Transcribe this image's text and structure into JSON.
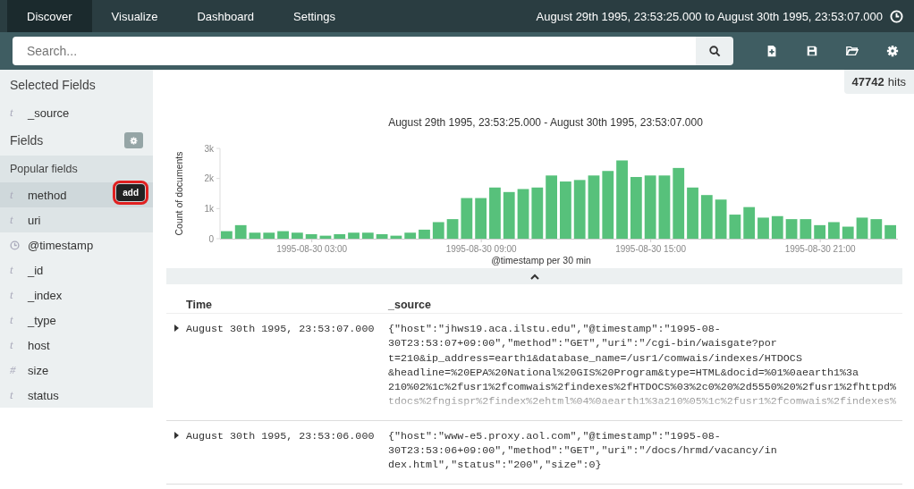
{
  "nav": {
    "tabs": [
      {
        "label": "Discover",
        "selected": true
      },
      {
        "label": "Visualize",
        "selected": false
      },
      {
        "label": "Dashboard",
        "selected": false
      },
      {
        "label": "Settings",
        "selected": false
      }
    ],
    "time_range": "August 29th 1995, 23:53:25.000 to August 30th 1995, 23:53:07.000"
  },
  "search": {
    "placeholder": "Search..."
  },
  "toolbar": [
    {
      "kind": "new"
    },
    {
      "kind": "save"
    },
    {
      "kind": "open"
    },
    {
      "kind": "settings"
    }
  ],
  "sidebar": {
    "selected_title": "Selected Fields",
    "selected_fields": [
      {
        "kind": "letter",
        "type_icon": "t",
        "name": "_source"
      }
    ],
    "fields_title": "Fields",
    "popular_title": "Popular fields",
    "popular_fields": [
      {
        "kind": "letter",
        "type_icon": "t",
        "name": "method",
        "add_button": {
          "label": "add",
          "highlighted": true
        }
      },
      {
        "kind": "letter",
        "type_icon": "t",
        "name": "uri"
      }
    ],
    "fields": [
      {
        "kind": "date",
        "name": "@timestamp"
      },
      {
        "kind": "letter",
        "type_icon": "t",
        "name": "_id"
      },
      {
        "kind": "letter",
        "type_icon": "t",
        "name": "_index"
      },
      {
        "kind": "letter",
        "type_icon": "t",
        "name": "_type"
      },
      {
        "kind": "letter",
        "type_icon": "t",
        "name": "host"
      },
      {
        "kind": "letter",
        "type_icon": "#",
        "name": "size"
      },
      {
        "kind": "letter",
        "type_icon": "t",
        "name": "status"
      }
    ]
  },
  "hits": {
    "count": "47742",
    "label": "hits"
  },
  "histogram": {
    "chart_data": {
      "type": "bar",
      "title": "August 29th 1995, 23:53:25.000 - August 30th 1995, 23:53:07.000",
      "xlabel": "@timestamp per 30 min",
      "ylabel": "Count of documents",
      "categories": [
        null,
        null,
        null,
        null,
        null,
        null,
        "1995-08-30 03:00",
        null,
        null,
        null,
        null,
        null,
        null,
        null,
        null,
        null,
        null,
        null,
        "1995-08-30 09:00",
        null,
        null,
        null,
        null,
        null,
        null,
        null,
        null,
        null,
        null,
        null,
        "1995-08-30 15:00",
        null,
        null,
        null,
        null,
        null,
        null,
        null,
        null,
        null,
        null,
        null,
        "1995-08-30 21:00",
        null,
        null,
        null,
        null,
        null
      ],
      "series": [
        {
          "color": "#57c17b",
          "values": [
            250,
            450,
            200,
            200,
            250,
            200,
            150,
            100,
            150,
            200,
            200,
            150,
            100,
            200,
            300,
            550,
            650,
            1350,
            1350,
            1700,
            1550,
            1650,
            1700,
            2100,
            1900,
            1950,
            2100,
            2250,
            2600,
            2050,
            2100,
            2100,
            2350,
            1700,
            1450,
            1300,
            800,
            1050,
            700,
            750,
            650,
            650,
            450,
            550,
            400,
            700,
            650,
            450
          ]
        }
      ],
      "ylim": [
        0,
        3000
      ],
      "yticks": [
        {
          "value": 0,
          "label": "0"
        },
        {
          "value": 1000,
          "label": "1k"
        },
        {
          "value": 2000,
          "label": "2k"
        },
        {
          "value": 3000,
          "label": "3k"
        }
      ]
    }
  },
  "table": {
    "columns": [
      "Time",
      "_source"
    ],
    "rows": [
      {
        "time": "August 30th 1995, 23:53:07.000",
        "truncated": true,
        "source_lines": [
          "{\"host\":\"jhws19.aca.ilstu.edu\",\"@timestamp\":\"1995-08-",
          "30T23:53:07+09:00\",\"method\":\"GET\",\"uri\":\"/cgi-bin/waisgate?por",
          "t=210&ip_address=earth1&database_name=/usr1/comwais/indexes/HTDOCS",
          "&headline=%20EPA%20National%20GIS%20Program&type=HTML&docid=%01%0aearth1%3a",
          "210%02%1c%2fusr1%2fcomwais%2findexes%2fHTDOCS%03%2c0%20%2d5550%20%2fusr1%2fhttpd%",
          "tdocs%2fngispr%2findex%2ehtml%04%0aearth1%3a210%05%1c%2fusr1%2fcomwais%2findexes%"
        ]
      },
      {
        "time": "August 30th 1995, 23:53:06.000",
        "truncated": false,
        "source_lines": [
          "{\"host\":\"www-e5.proxy.aol.com\",\"@timestamp\":\"1995-08-",
          "30T23:53:06+09:00\",\"method\":\"GET\",\"uri\":\"/docs/hrmd/vacancy/in",
          "dex.html\",\"status\":\"200\",\"size\":0}"
        ]
      }
    ]
  }
}
